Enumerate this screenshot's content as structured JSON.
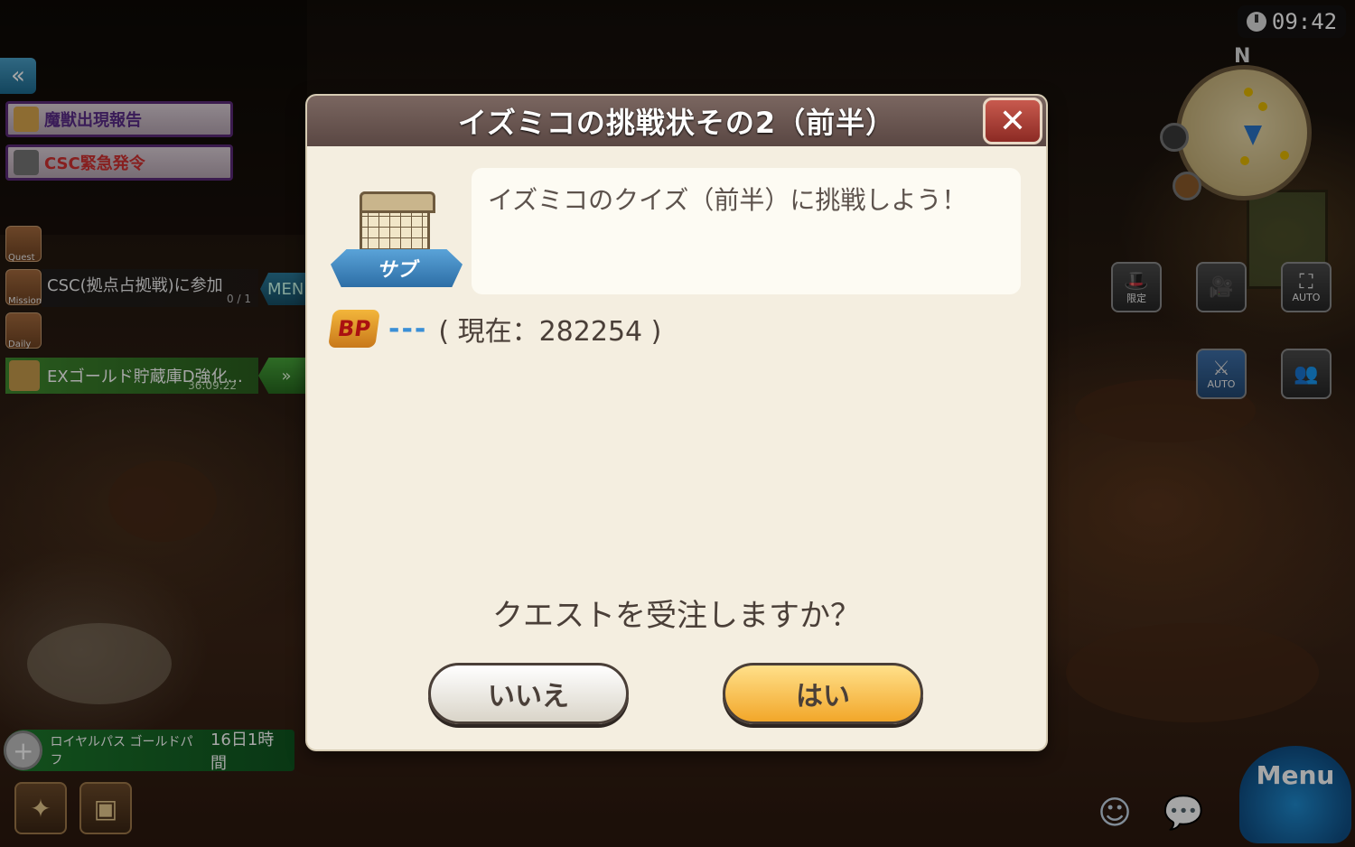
{
  "clock": {
    "time": "09:42",
    "icon": "clock-icon"
  },
  "minimap": {
    "compass": "N"
  },
  "alerts": [
    {
      "label": "魔獣出現報告",
      "icon": "fox-icon"
    },
    {
      "label": "CSC緊急発令",
      "icon": "gear-icon"
    }
  ],
  "side_icons": {
    "quest": "Quest",
    "mission": "Mission",
    "daily": "Daily"
  },
  "quest_tracker": {
    "title": "CSC(拠点占拠戦)に参加",
    "progress": "0 / 1",
    "menu_tab": "MEN"
  },
  "gold_task": {
    "title": "EXゴールド貯蔵庫D強化...",
    "timer": "36:09:22"
  },
  "royal_pass": {
    "name": "ロイヤルパス ゴールドパフ",
    "duration": "16日1時間"
  },
  "tool_buttons": {
    "limited": "限定",
    "auto1": "AUTO",
    "auto2": "AUTO"
  },
  "menu_button": {
    "label": "Menu"
  },
  "dialog": {
    "title": "イズミコの挑戦状その2（前半）",
    "badge_label": "サブ",
    "description": "イズミコのクイズ（前半）に挑戦しよう！",
    "bp_label": "BP",
    "bp_value": "---",
    "bp_current": "( 現在：282254 )",
    "question": "クエストを受注しますか？",
    "no_label": "いいえ",
    "yes_label": "はい"
  }
}
